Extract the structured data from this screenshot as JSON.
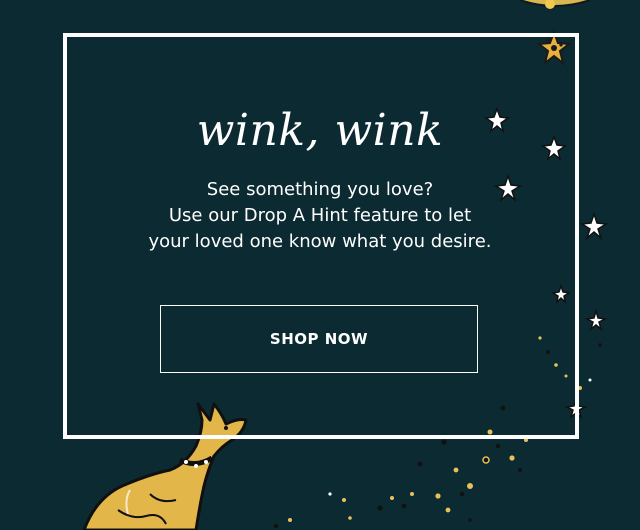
{
  "colors": {
    "background": "#0b2a31",
    "frame": "#ffffff",
    "text": "#ffffff",
    "accent_gold": "#e8b94a"
  },
  "card": {
    "headline": "wink, wink",
    "body_lines": [
      "See something you love?",
      "Use our Drop A Hint feature to let",
      "your loved one know what you desire."
    ],
    "cta_label": "SHOP NOW"
  },
  "decorations": {
    "stars_icon": "sparkle-star-icon",
    "creature_icon": "kangaroo-illustration"
  }
}
